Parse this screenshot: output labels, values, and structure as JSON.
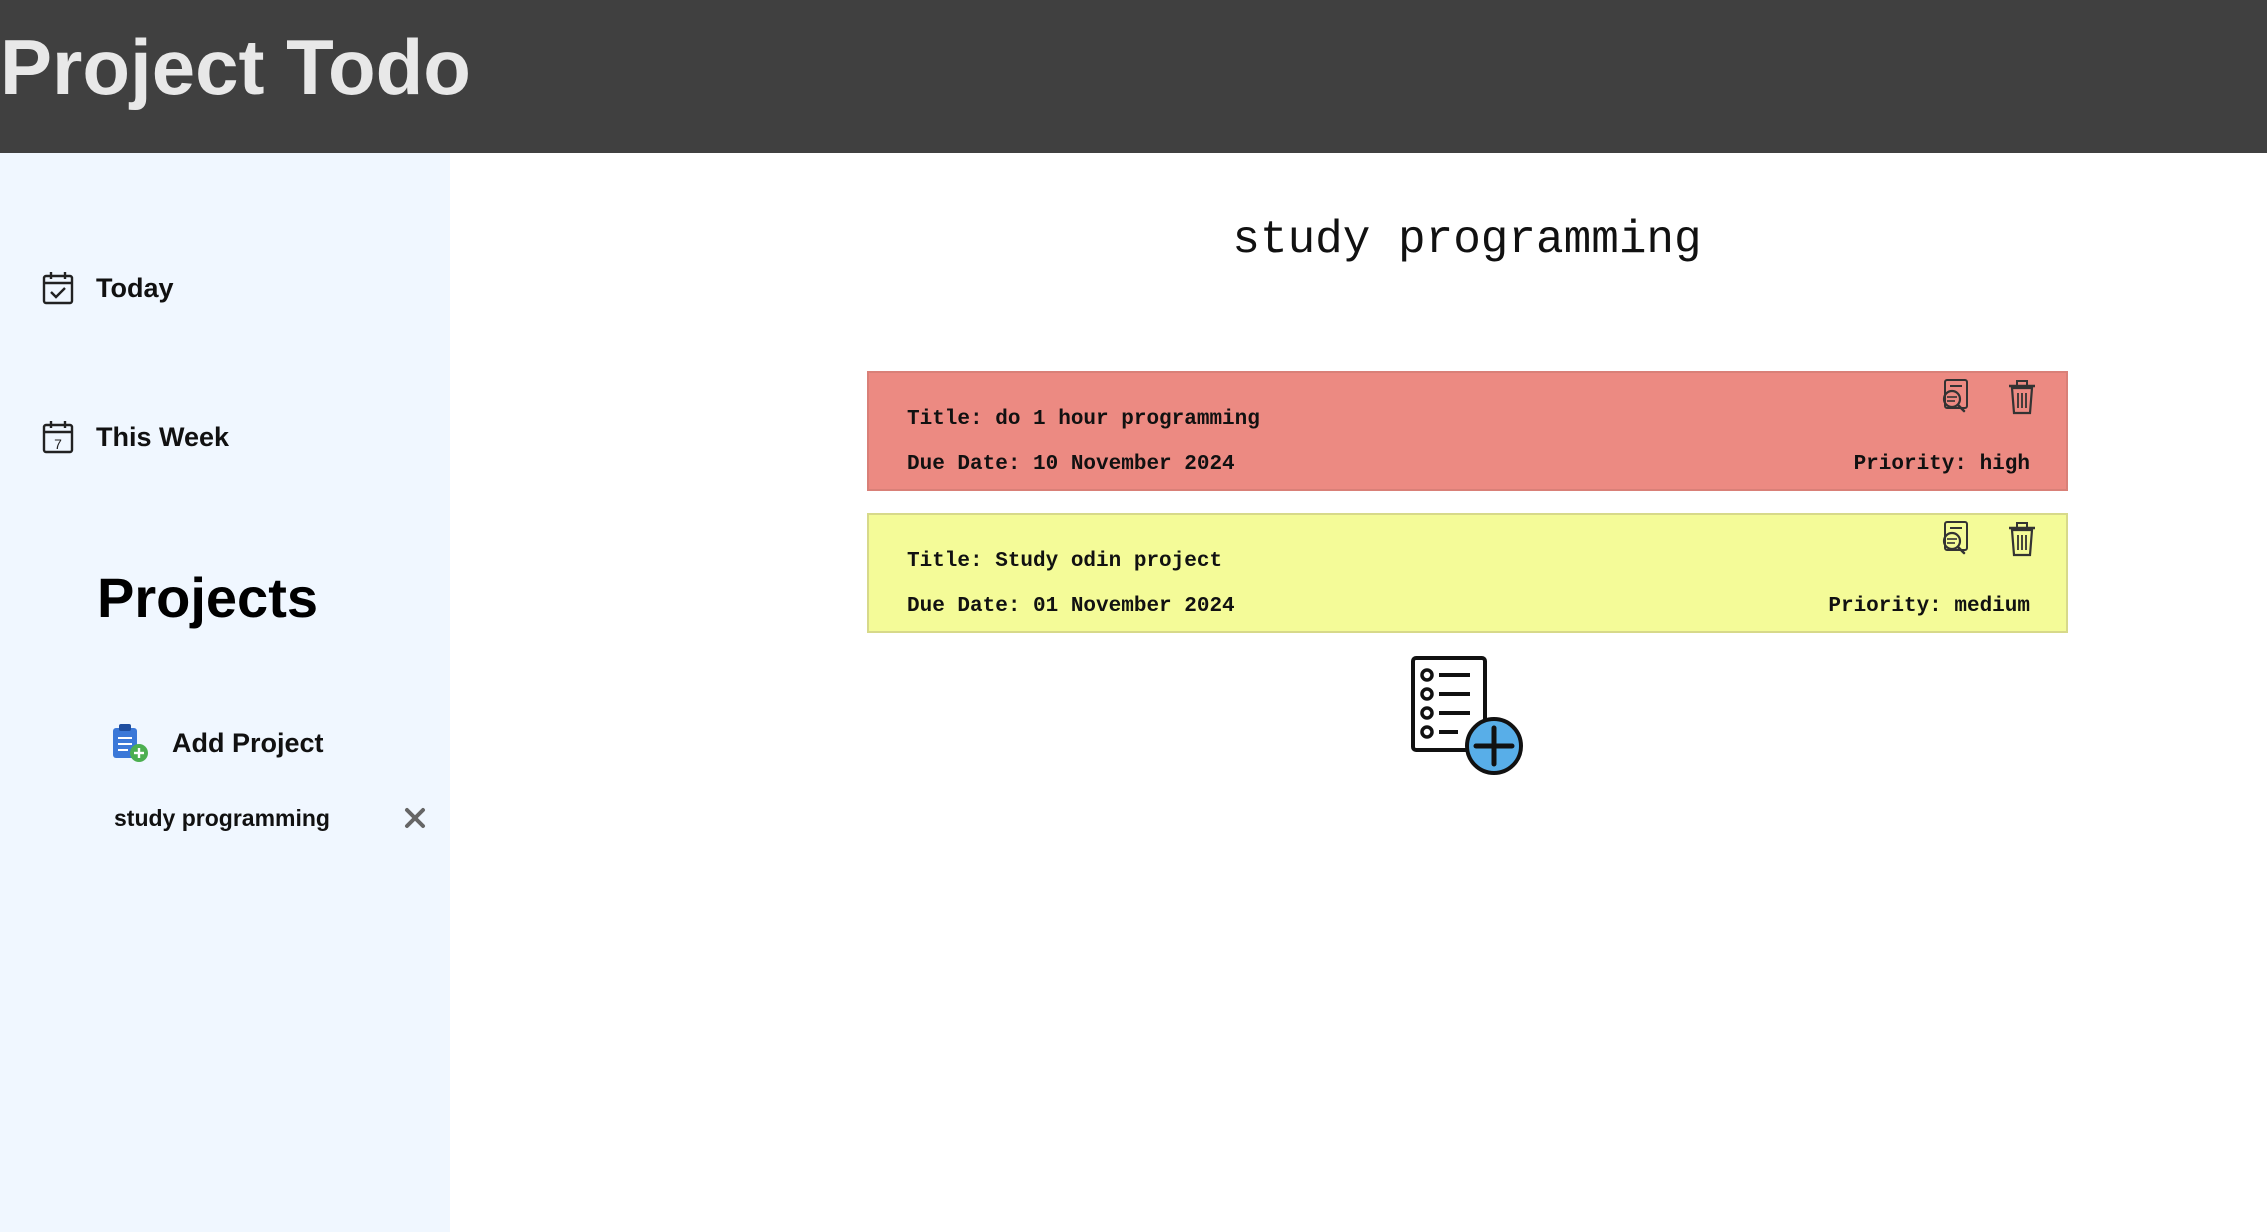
{
  "header": {
    "app_title": "Project Todo"
  },
  "sidebar": {
    "nav": [
      {
        "label": "Today",
        "icon": "calendar-check-icon"
      },
      {
        "label": "This Week",
        "icon": "calendar-week-icon"
      }
    ],
    "projects_heading": "Projects",
    "add_project_label": "Add Project",
    "projects": [
      {
        "label": "study programming"
      }
    ]
  },
  "main": {
    "project_title": "study programming",
    "todos": [
      {
        "title": "Title: do 1 hour programming",
        "due": "Due Date: 10 November 2024",
        "priority": "Priority: high",
        "color": "#ec8a82"
      },
      {
        "title": "Title: Study odin project",
        "due": "Due Date: 01 November 2024",
        "priority": "Priority: medium",
        "color": "#f4fb98"
      }
    ],
    "add_todo_icon": "add-task-icon"
  },
  "colors": {
    "header_bg": "#404040",
    "sidebar_bg": "#f0f7ff",
    "high": "#ec8a82",
    "medium": "#f4fb98",
    "accent_blue": "#58aee8"
  }
}
